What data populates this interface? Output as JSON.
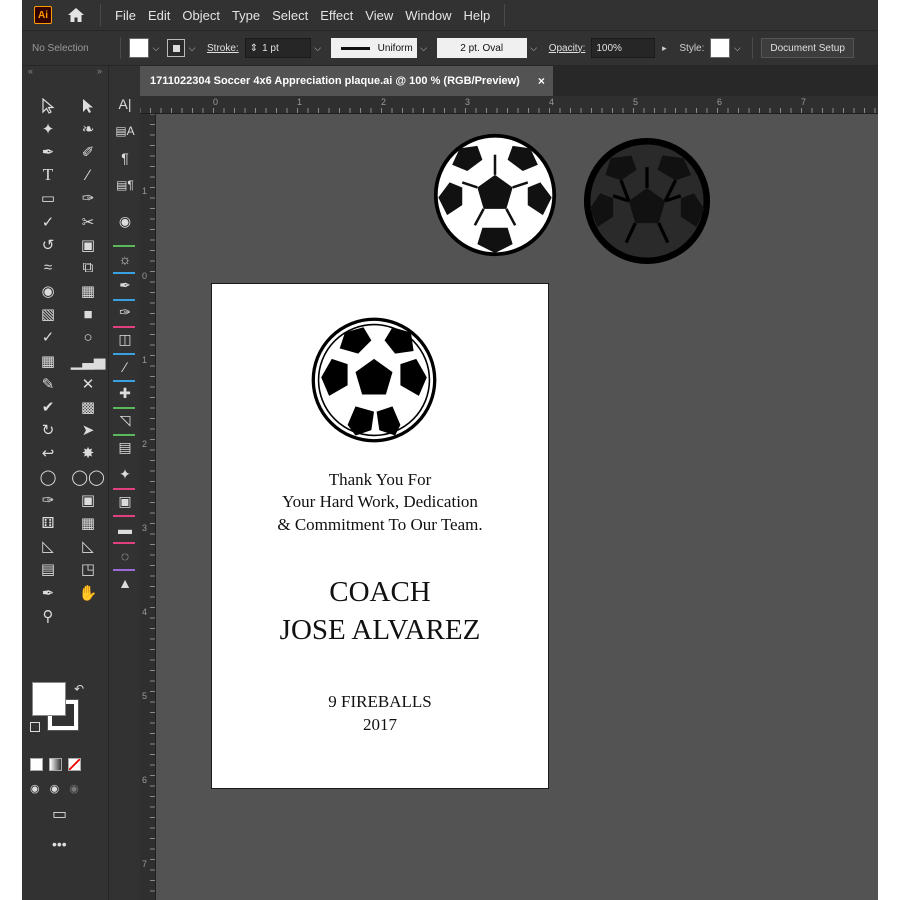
{
  "app": {
    "logo": "Ai"
  },
  "menu": [
    "File",
    "Edit",
    "Object",
    "Type",
    "Select",
    "Effect",
    "View",
    "Window",
    "Help"
  ],
  "control_bar": {
    "selection": "No Selection",
    "stroke_label": "Stroke:",
    "stroke_weight": "1 pt",
    "stroke_profile": "Uniform",
    "brush": "2 pt. Oval",
    "opacity_label": "Opacity:",
    "opacity_value": "100%",
    "style_label": "Style:",
    "document_setup": "Document Setup"
  },
  "document": {
    "tab_title": "1711022304 Soccer 4x6 Appreciation plaque.ai @ 100 % (RGB/Preview)",
    "close_glyph": "×"
  },
  "rulers": {
    "horizontal": [
      "0",
      "1",
      "2",
      "3",
      "4",
      "5",
      "6",
      "7"
    ],
    "vertical": [
      "1",
      "0",
      "1",
      "2",
      "3",
      "4",
      "5",
      "6",
      "7"
    ]
  },
  "plaque": {
    "line1": "Thank You For",
    "line2": "Your Hard Work, Dedication",
    "line3": "& Commitment To Our Team.",
    "coach_label": "COACH",
    "coach_name": "JOSE ALVAREZ",
    "team": "9 FIREBALLS",
    "year": "2017"
  },
  "toolbar_more": "•••",
  "colors": {
    "ui_dark": "#323232",
    "canvas": "#535353",
    "artboard": "#ffffff",
    "accent_logo": "#ff9a00"
  }
}
